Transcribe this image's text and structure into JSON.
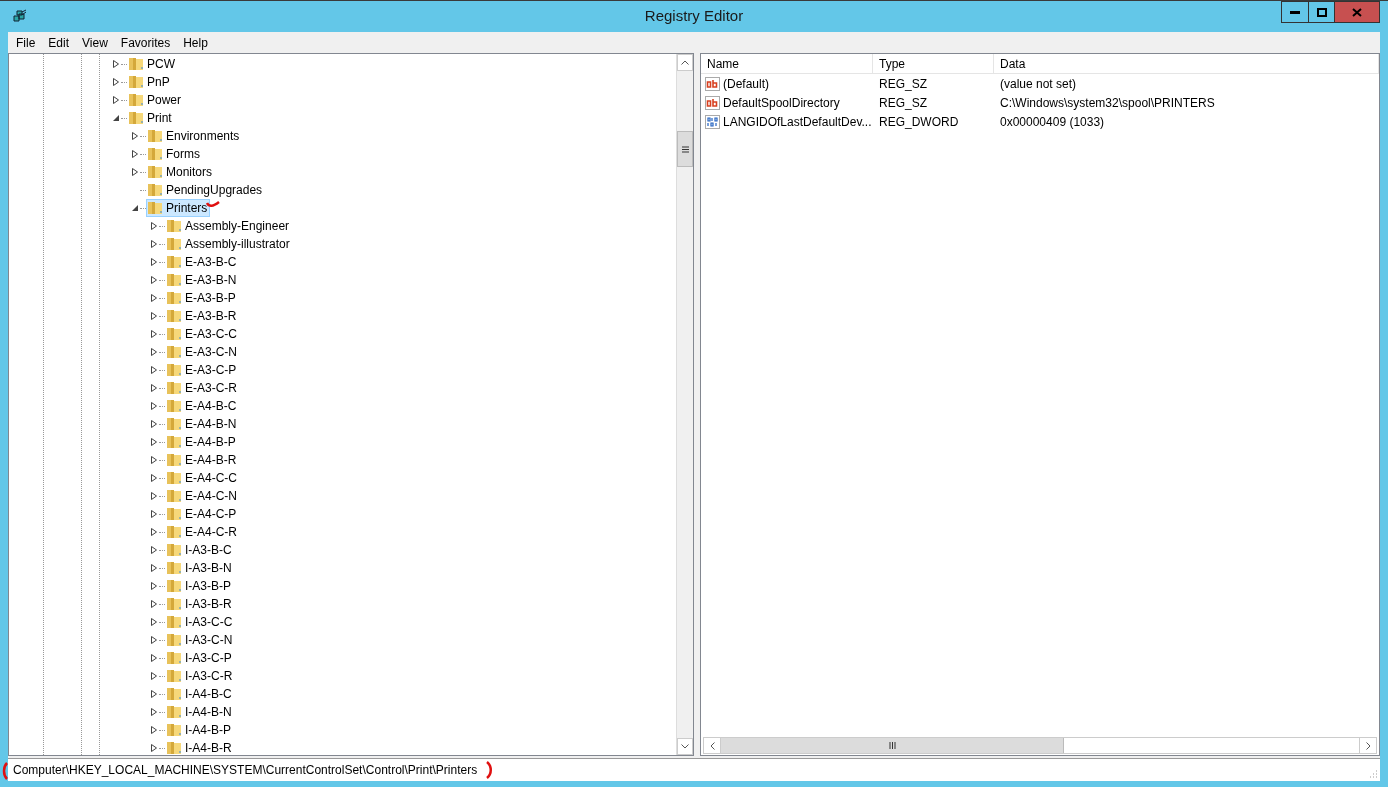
{
  "window": {
    "title": "Registry Editor"
  },
  "menu": [
    "File",
    "Edit",
    "View",
    "Favorites",
    "Help"
  ],
  "tree": [
    {
      "label": "PCW",
      "expanded": false,
      "selected": false
    },
    {
      "label": "PnP",
      "expanded": false,
      "selected": false
    },
    {
      "label": "Power",
      "expanded": false,
      "selected": false
    },
    {
      "label": "Print",
      "expanded": true,
      "selected": false,
      "children": [
        {
          "label": "Environments",
          "expanded": false,
          "selected": false
        },
        {
          "label": "Forms",
          "expanded": false,
          "selected": false
        },
        {
          "label": "Monitors",
          "expanded": false,
          "selected": false
        },
        {
          "label": "PendingUpgrades",
          "selected": false
        },
        {
          "label": "Printers",
          "expanded": true,
          "selected": true,
          "children": [
            {
              "label": "Assembly-Engineer",
              "expanded": false,
              "selected": false
            },
            {
              "label": "Assembly-illustrator",
              "expanded": false,
              "selected": false
            },
            {
              "label": "E-A3-B-C",
              "expanded": false,
              "selected": false
            },
            {
              "label": "E-A3-B-N",
              "expanded": false,
              "selected": false
            },
            {
              "label": "E-A3-B-P",
              "expanded": false,
              "selected": false
            },
            {
              "label": "E-A3-B-R",
              "expanded": false,
              "selected": false
            },
            {
              "label": "E-A3-C-C",
              "expanded": false,
              "selected": false
            },
            {
              "label": "E-A3-C-N",
              "expanded": false,
              "selected": false
            },
            {
              "label": "E-A3-C-P",
              "expanded": false,
              "selected": false
            },
            {
              "label": "E-A3-C-R",
              "expanded": false,
              "selected": false
            },
            {
              "label": "E-A4-B-C",
              "expanded": false,
              "selected": false
            },
            {
              "label": "E-A4-B-N",
              "expanded": false,
              "selected": false
            },
            {
              "label": "E-A4-B-P",
              "expanded": false,
              "selected": false
            },
            {
              "label": "E-A4-B-R",
              "expanded": false,
              "selected": false
            },
            {
              "label": "E-A4-C-C",
              "expanded": false,
              "selected": false
            },
            {
              "label": "E-A4-C-N",
              "expanded": false,
              "selected": false
            },
            {
              "label": "E-A4-C-P",
              "expanded": false,
              "selected": false
            },
            {
              "label": "E-A4-C-R",
              "expanded": false,
              "selected": false
            },
            {
              "label": "I-A3-B-C",
              "expanded": false,
              "selected": false
            },
            {
              "label": "I-A3-B-N",
              "expanded": false,
              "selected": false
            },
            {
              "label": "I-A3-B-P",
              "expanded": false,
              "selected": false
            },
            {
              "label": "I-A3-B-R",
              "expanded": false,
              "selected": false
            },
            {
              "label": "I-A3-C-C",
              "expanded": false,
              "selected": false
            },
            {
              "label": "I-A3-C-N",
              "expanded": false,
              "selected": false
            },
            {
              "label": "I-A3-C-P",
              "expanded": false,
              "selected": false
            },
            {
              "label": "I-A3-C-R",
              "expanded": false,
              "selected": false
            },
            {
              "label": "I-A4-B-C",
              "expanded": false,
              "selected": false
            },
            {
              "label": "I-A4-B-N",
              "expanded": false,
              "selected": false
            },
            {
              "label": "I-A4-B-P",
              "expanded": false,
              "selected": false
            },
            {
              "label": "I-A4-B-R",
              "expanded": false,
              "selected": false
            }
          ]
        }
      ]
    }
  ],
  "values": {
    "columns": [
      "Name",
      "Type",
      "Data"
    ],
    "rows": [
      {
        "kind": "string",
        "name": "(Default)",
        "type": "REG_SZ",
        "data": "(value not set)"
      },
      {
        "kind": "string",
        "name": "DefaultSpoolDirectory",
        "type": "REG_SZ",
        "data": "C:\\Windows\\system32\\spool\\PRINTERS"
      },
      {
        "kind": "dword",
        "name": "LANGIDOfLastDefaultDev...",
        "type": "REG_DWORD",
        "data": "0x00000409 (1033)"
      }
    ]
  },
  "status_bar": "Computer\\HKEY_LOCAL_MACHINE\\SYSTEM\\CurrentControlSet\\Control\\Print\\Printers"
}
